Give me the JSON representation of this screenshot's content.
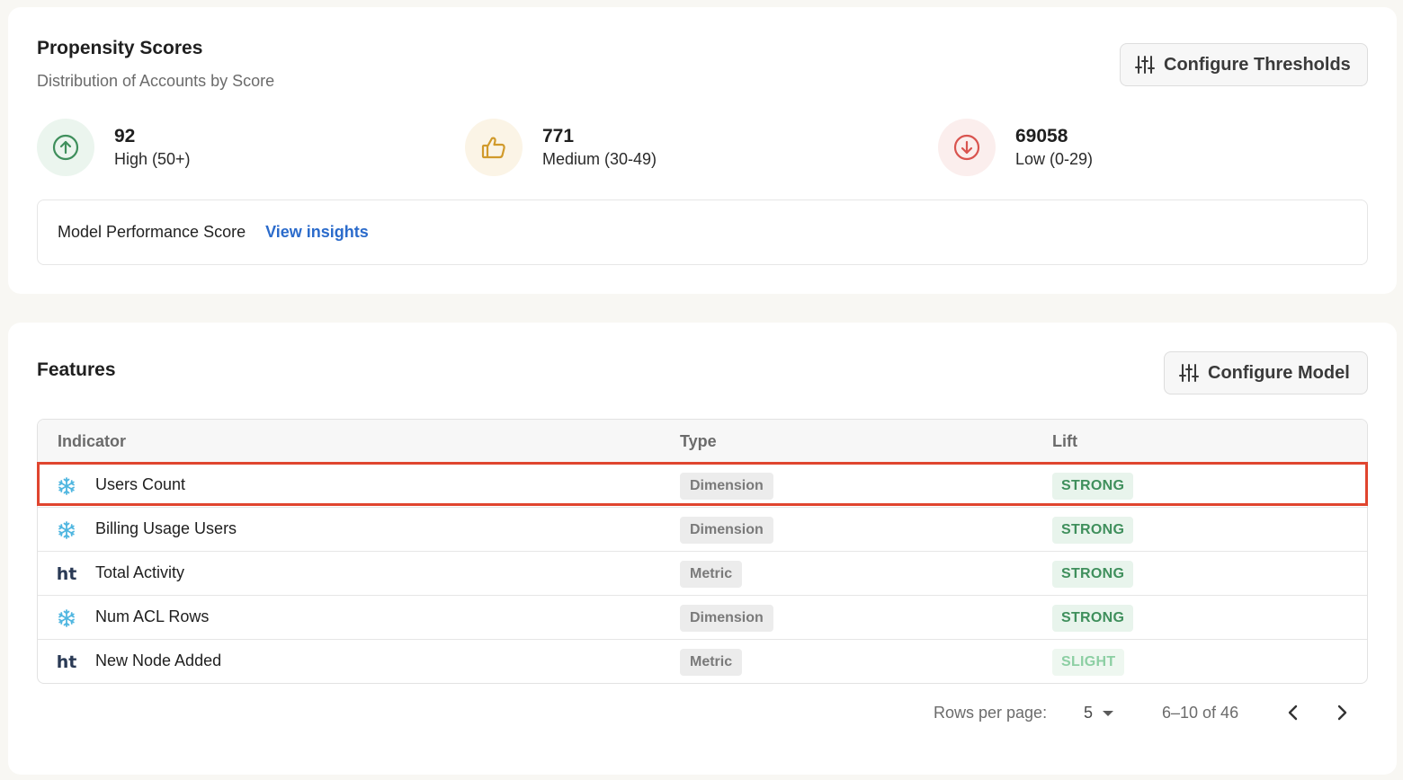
{
  "propensity": {
    "title": "Propensity Scores",
    "subtitle": "Distribution of Accounts by Score",
    "configure_button": "Configure Thresholds",
    "stats": [
      {
        "value": "92",
        "label": "High (50+)",
        "icon": "arrow-up-circle-icon",
        "color": "#3f8f5c"
      },
      {
        "value": "771",
        "label": "Medium (30-49)",
        "icon": "thumbs-up-icon",
        "color": "#d19a2b"
      },
      {
        "value": "69058",
        "label": "Low (0-29)",
        "icon": "arrow-down-circle-icon",
        "color": "#d9544f"
      }
    ],
    "performance": {
      "label": "Model Performance Score",
      "link": "View insights"
    }
  },
  "features": {
    "title": "Features",
    "configure_button": "Configure Model",
    "columns": {
      "indicator": "Indicator",
      "type": "Type",
      "lift": "Lift"
    },
    "rows": [
      {
        "icon": "snowflake-icon",
        "name": "Users Count",
        "type": "Dimension",
        "lift": "STRONG"
      },
      {
        "icon": "snowflake-icon",
        "name": "Billing Usage Users",
        "type": "Dimension",
        "lift": "STRONG"
      },
      {
        "icon": "ht-icon",
        "icon_text": "ht",
        "name": "Total Activity",
        "type": "Metric",
        "lift": "STRONG"
      },
      {
        "icon": "snowflake-icon",
        "name": "Num ACL Rows",
        "type": "Dimension",
        "lift": "STRONG"
      },
      {
        "icon": "ht-icon",
        "icon_text": "ht",
        "name": "New Node Added",
        "type": "Metric",
        "lift": "SLIGHT"
      }
    ],
    "pagination": {
      "rows_per_page_label": "Rows per page:",
      "rows_per_page": "5",
      "range": "6–10 of 46"
    }
  },
  "colors": {
    "accent_link": "#2b6bcb",
    "highlight": "#e0452f"
  }
}
